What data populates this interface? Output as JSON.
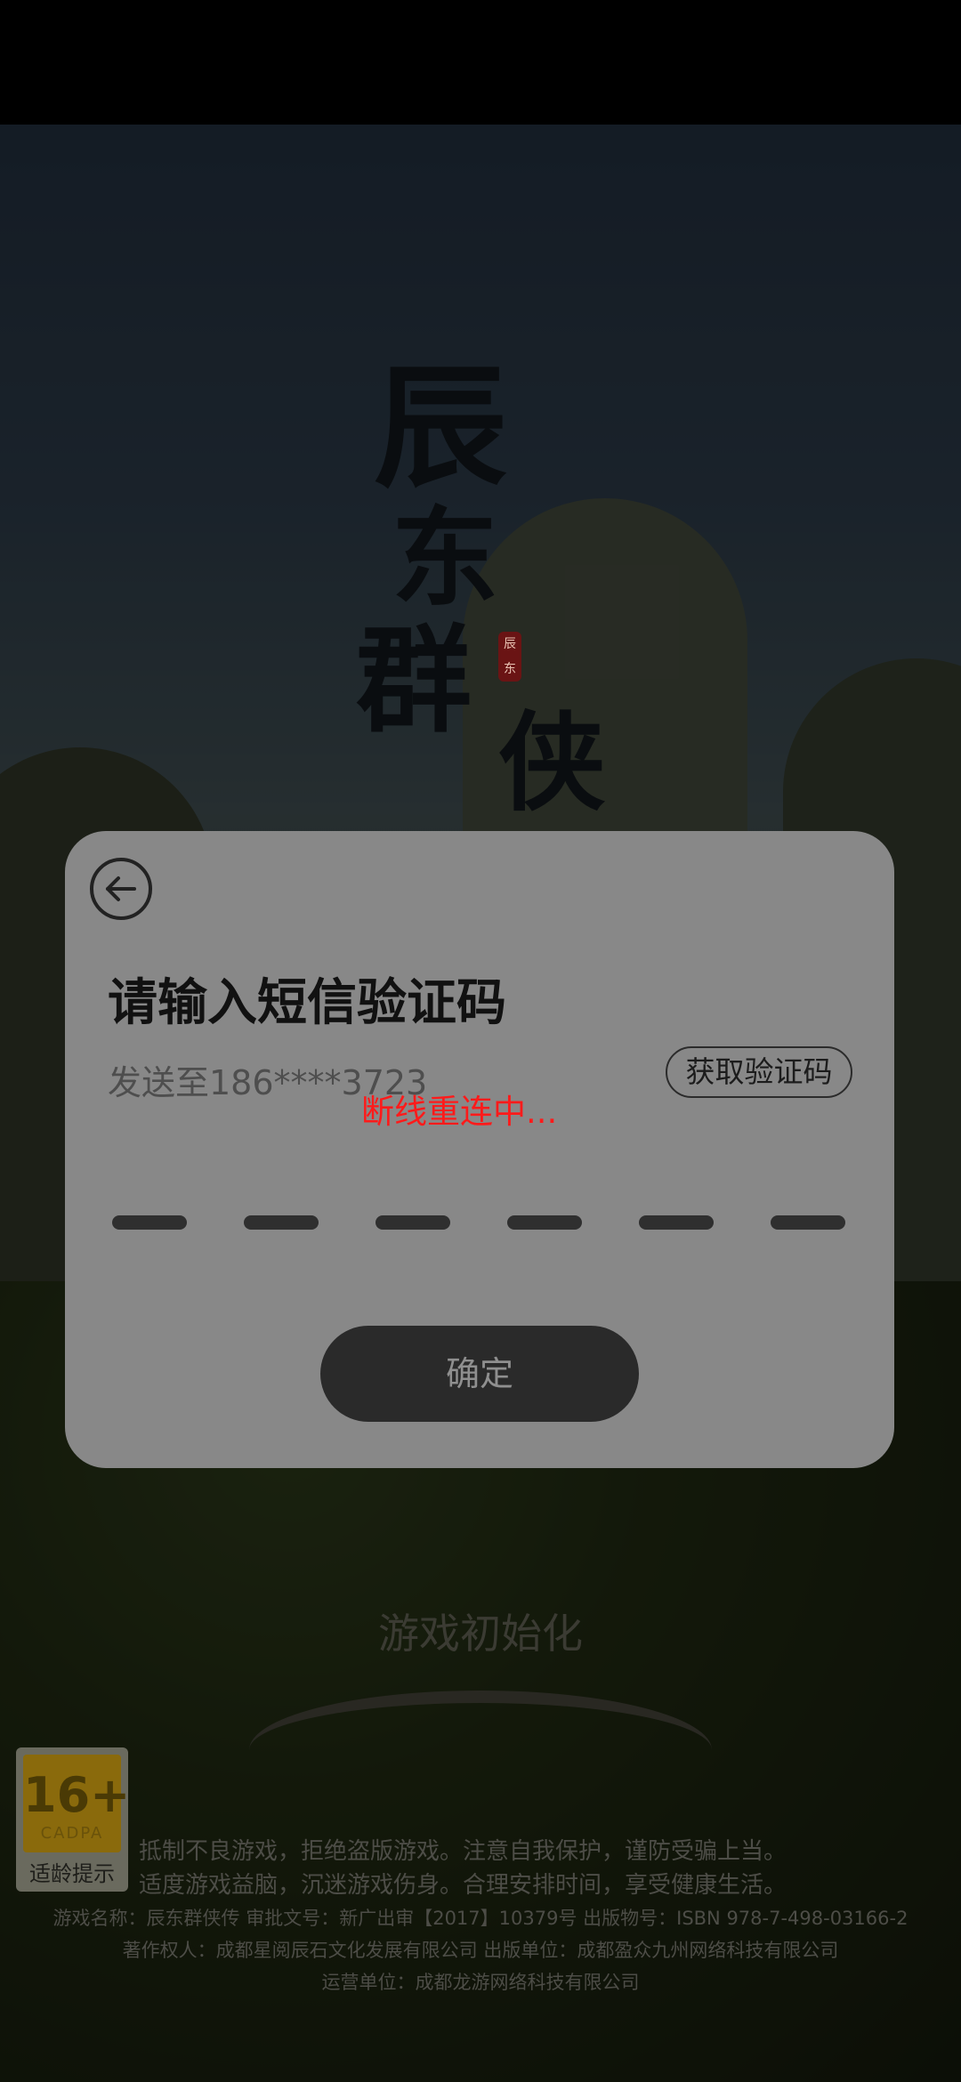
{
  "game": {
    "logo_text": "辰东群侠",
    "seal_text": "辰东",
    "init_status": "游戏初始化"
  },
  "dialog": {
    "title": "请输入短信验证码",
    "sent_to": "发送至186****3723",
    "get_code_label": "获取验证码",
    "reconnect_text": "断线重连中...",
    "code_slot_count": 6,
    "confirm_label": "确定"
  },
  "age_rating": {
    "age": "16+",
    "org": "CADPA",
    "label": "适龄提示"
  },
  "notices": {
    "line1": "抵制不良游戏，拒绝盗版游戏。注意自我保护，谨防受骗上当。",
    "line2": "适度游戏益脑，沉迷游戏伤身。合理安排时间，享受健康生活。"
  },
  "footer": {
    "line1": "游戏名称：辰东群侠传  审批文号：新广出审【2017】10379号  出版物号：ISBN 978-7-498-03166-2",
    "line2": "著作权人：成都星阅辰石文化发展有限公司  出版单位：成都盈众九州网络科技有限公司",
    "line3": "运营单位：成都龙游网络科技有限公司"
  },
  "colors": {
    "dialog_bg": "#888888",
    "reconnect": "#ff1a1a",
    "confirm_bg": "#2a2a2a"
  }
}
